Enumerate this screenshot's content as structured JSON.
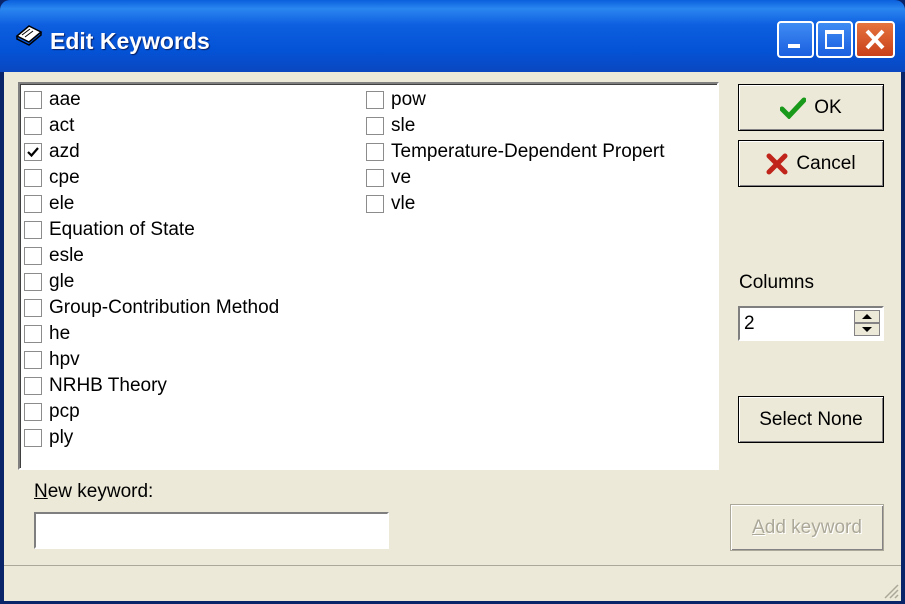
{
  "window": {
    "title": "Edit Keywords"
  },
  "titlebar_buttons": [
    "minimize-button",
    "maximize-button",
    "close-button"
  ],
  "keywords": {
    "column1": [
      {
        "label": "aae",
        "checked": false
      },
      {
        "label": "act",
        "checked": false
      },
      {
        "label": "azd",
        "checked": true
      },
      {
        "label": "cpe",
        "checked": false
      },
      {
        "label": "ele",
        "checked": false
      },
      {
        "label": "Equation of State",
        "checked": false
      },
      {
        "label": "esle",
        "checked": false
      },
      {
        "label": "gle",
        "checked": false
      },
      {
        "label": "Group-Contribution Method",
        "checked": false
      },
      {
        "label": "he",
        "checked": false
      },
      {
        "label": "hpv",
        "checked": false
      },
      {
        "label": "NRHB Theory",
        "checked": false
      },
      {
        "label": "pcp",
        "checked": false
      },
      {
        "label": "ply",
        "checked": false
      }
    ],
    "column2": [
      {
        "label": "pow",
        "checked": false
      },
      {
        "label": "sle",
        "checked": false
      },
      {
        "label": "Temperature-Dependent Propert",
        "checked": false
      },
      {
        "label": "ve",
        "checked": false
      },
      {
        "label": "vle",
        "checked": false
      }
    ]
  },
  "buttons": {
    "ok": "OK",
    "cancel": "Cancel",
    "select_none": "Select None",
    "add_keyword": "Add keyword"
  },
  "columns": {
    "label": "Columns",
    "value": "2"
  },
  "new_keyword": {
    "label": "New keyword:",
    "value": ""
  },
  "colors": {
    "title_blue": "#0453d6",
    "ok_check": "#1a9a1a",
    "cancel_x": "#c0241a",
    "face": "#ece9d8"
  }
}
